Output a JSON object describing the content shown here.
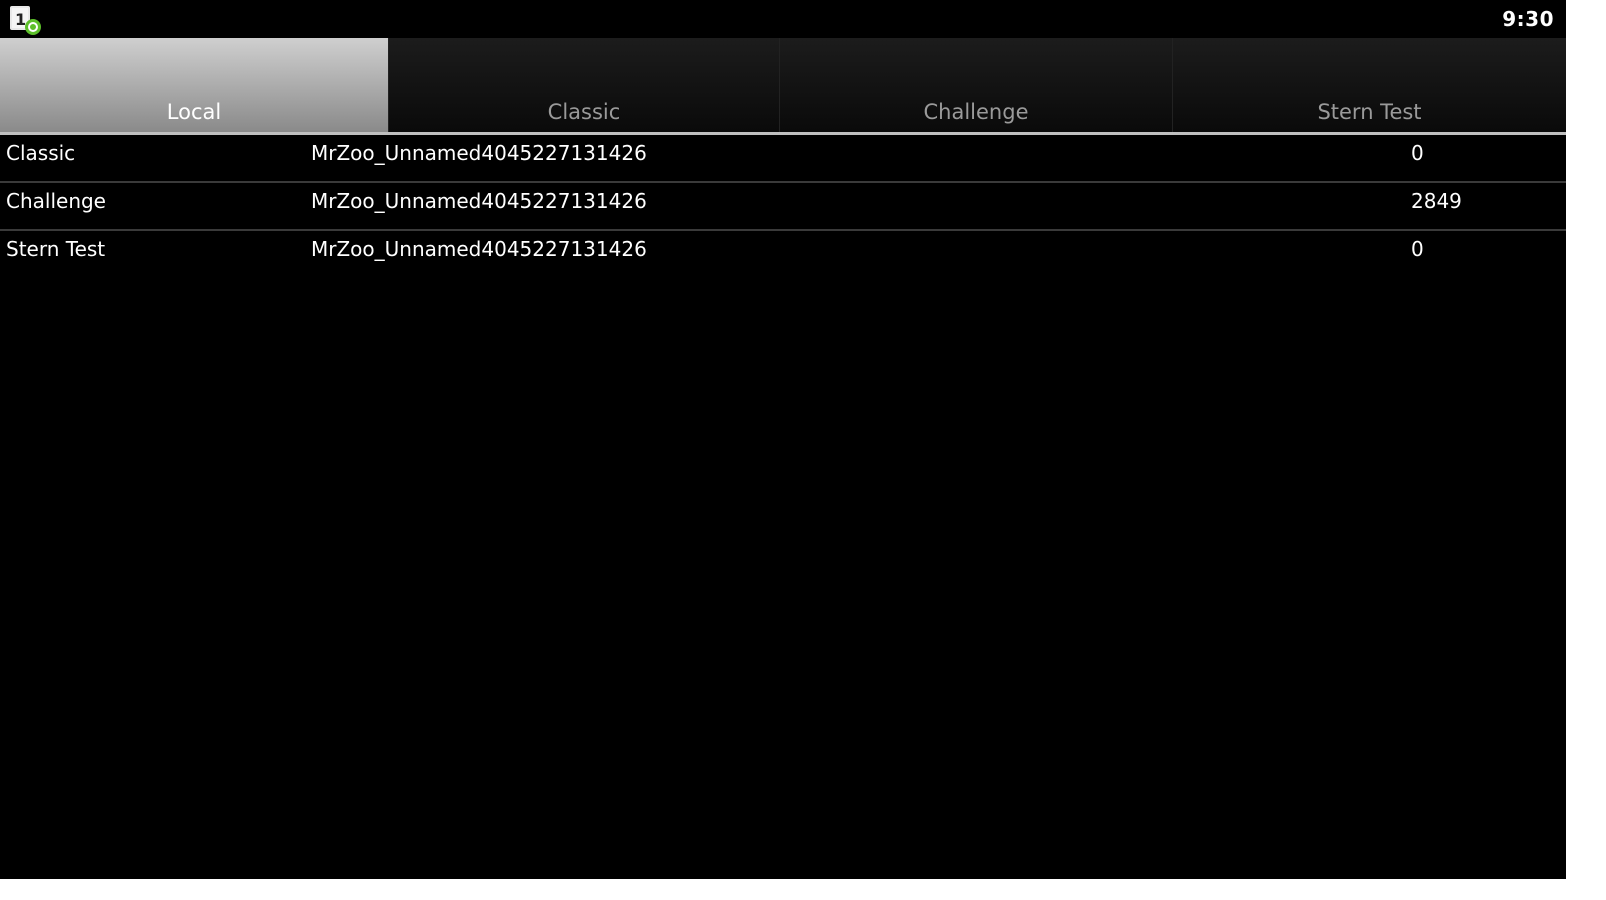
{
  "status_bar": {
    "time": "9:30",
    "notification_icon": "notification-icon"
  },
  "tabs": [
    {
      "label": "Local",
      "selected": true
    },
    {
      "label": "Classic",
      "selected": false
    },
    {
      "label": "Challenge",
      "selected": false
    },
    {
      "label": "Stern Test",
      "selected": false
    }
  ],
  "scores": [
    {
      "mode": "Classic",
      "player": "MrZoo_Unnamed4045227131426",
      "score": "0"
    },
    {
      "mode": "Challenge",
      "player": "MrZoo_Unnamed4045227131426",
      "score": "2849"
    },
    {
      "mode": "Stern Test",
      "player": "MrZoo_Unnamed4045227131426",
      "score": "0"
    }
  ],
  "colors": {
    "background": "#000000",
    "selected_tab": "#bdbdbd",
    "notification_badge": "#5cbf2a"
  }
}
